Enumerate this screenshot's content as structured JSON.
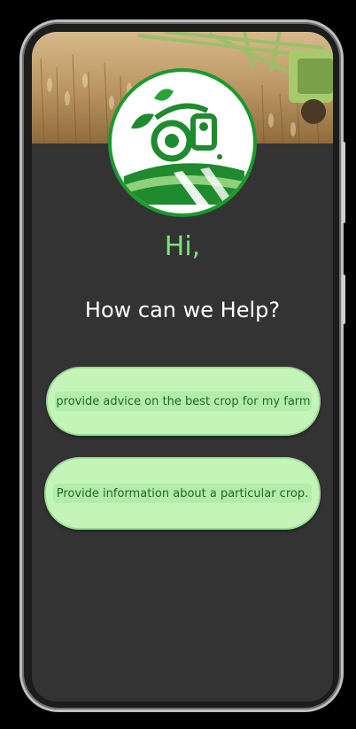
{
  "greeting": {
    "text": "Hi,"
  },
  "headline": {
    "text": "How can we Help?"
  },
  "options": [
    {
      "label": "provide advice on the best crop for my farm"
    },
    {
      "label": "Provide information about a particular crop."
    }
  ],
  "icons": {
    "banner": "harvester-field-image",
    "logo": "farm-tractor-logo-icon"
  },
  "colors": {
    "background": "#333333",
    "greeting": "#7fe07f",
    "option_bg": "#c3f5b8",
    "option_text": "#1f6b22",
    "logo_green": "#1a9a2c"
  }
}
